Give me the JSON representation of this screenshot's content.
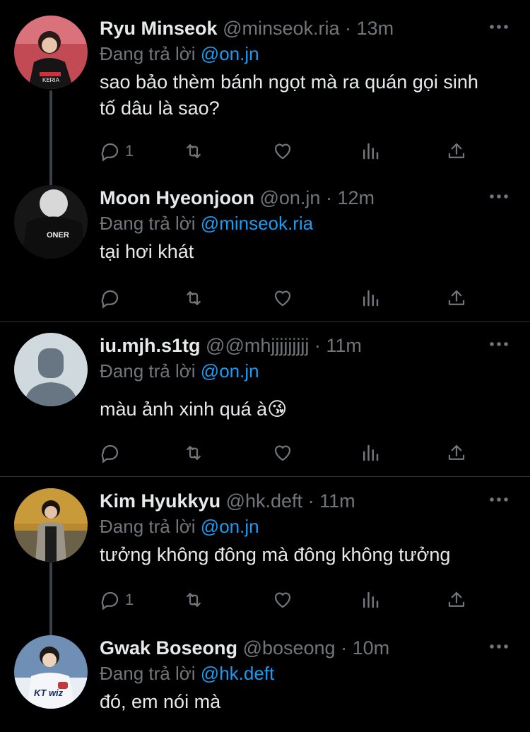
{
  "colors": {
    "background": "#000000",
    "text": "#e7e9ea",
    "muted": "#71767b",
    "accent": "#1d9bf0",
    "separator": "#2f3336"
  },
  "tweets": [
    {
      "name": "Ryu Minseok",
      "handle": "@minseok.ria",
      "time": "13m",
      "reply_prefix": "Đang trả lời",
      "reply_to": "@on.jn",
      "text": "sao bảo thèm bánh ngọt mà ra quán gọi sinh tố dâu là sao?",
      "reply_count": "1"
    },
    {
      "name": "Moon Hyeonjoon",
      "handle": "@on.jn",
      "time": "12m",
      "reply_prefix": "Đang trả lời",
      "reply_to": "@minseok.ria",
      "text": "tại hơi khát",
      "reply_count": ""
    },
    {
      "name": "iu.mjh.s1tg",
      "handle": "@@mhjjjjjjjjj",
      "time": "11m",
      "reply_prefix": "Đang trả lời",
      "reply_to": "@on.jn",
      "text": "màu ảnh xinh quá à😘",
      "reply_count": ""
    },
    {
      "name": "Kim Hyukkyu",
      "handle": "@hk.deft",
      "time": "11m",
      "reply_prefix": "Đang trả lời",
      "reply_to": "@on.jn",
      "text": "tưởng không đông mà đông không tưởng",
      "reply_count": "1"
    },
    {
      "name": "Gwak Boseong",
      "handle": "@boseong",
      "time": "10m",
      "reply_prefix": "Đang trả lời",
      "reply_to": "@hk.deft",
      "text": "đó, em nói mà",
      "reply_count": ""
    }
  ],
  "separator_dot": "·",
  "icons": [
    "more-icon",
    "reply-icon",
    "retweet-icon",
    "like-icon",
    "views-icon",
    "share-icon"
  ]
}
